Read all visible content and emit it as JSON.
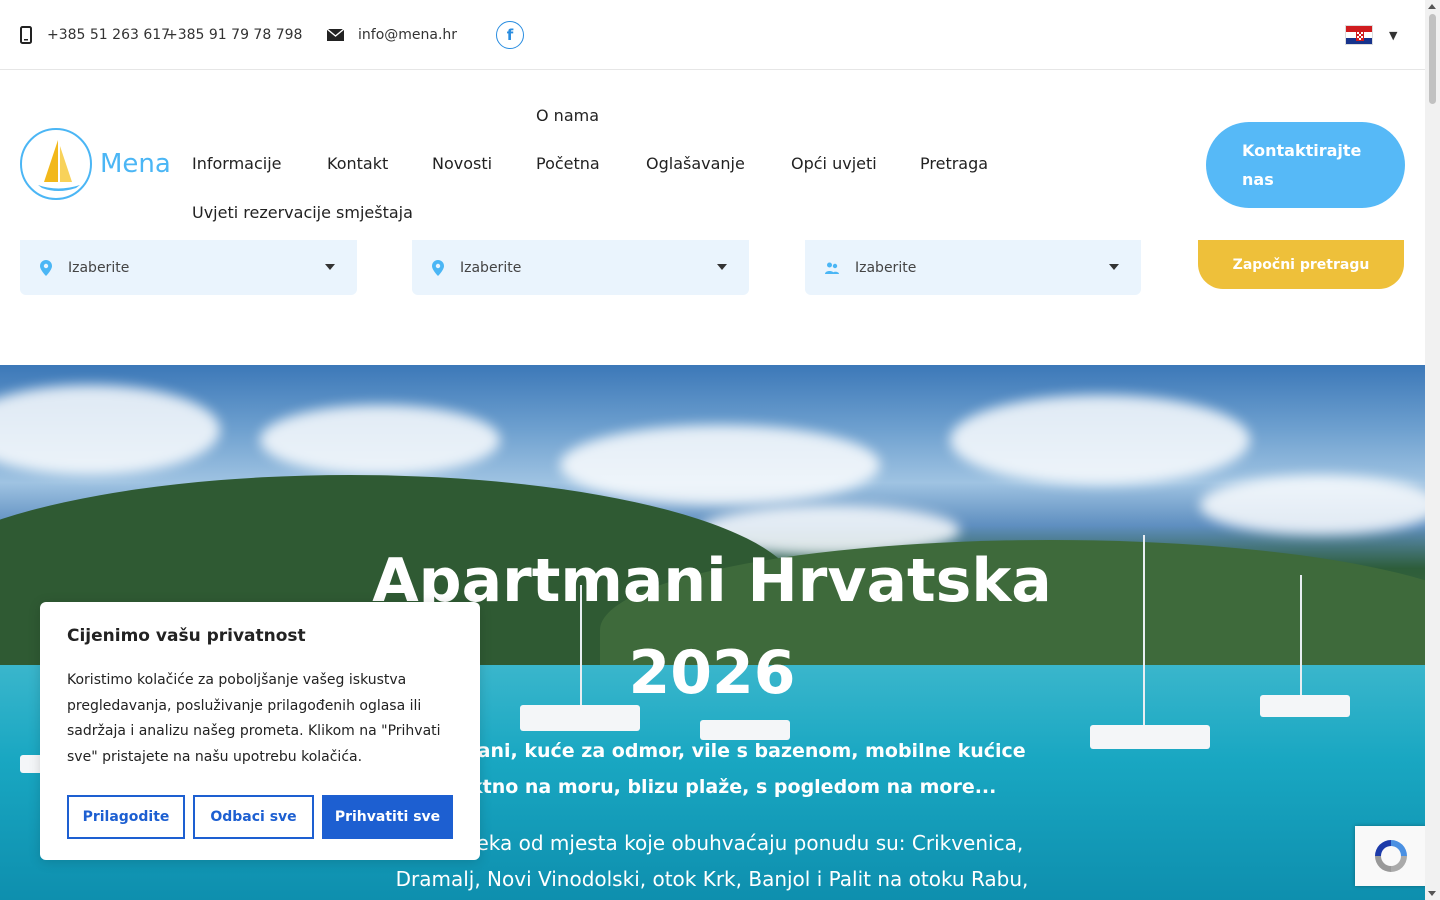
{
  "topbar": {
    "phone_icon": "mobile-phone-icon",
    "phone1": "+385 51 263 617",
    "phone2": "+385 91 79 78 798",
    "mail_icon": "envelope-icon",
    "email": "info@mena.hr",
    "facebook_icon": "facebook-icon",
    "facebook_glyph": "f",
    "language_flag": "croatia-flag-icon",
    "language_caret": "▼"
  },
  "header": {
    "logo_text": "Mena",
    "nav": {
      "o_nama": "O nama",
      "informacije": "Informacije",
      "kontakt": "Kontakt",
      "novosti": "Novosti",
      "pocetna": "Početna",
      "oglasavanje": "Oglašavanje",
      "opci_uvjeti": "Opći uvjeti",
      "pretraga": "Pretraga",
      "uvjeti_rezervacije": "Uvjeti rezervacije smještaja"
    },
    "cta_label": "Kontaktirajte nas"
  },
  "search": {
    "field1": "Izaberite",
    "field2": "Izaberite",
    "field3": "Izaberite",
    "button_label": "Započni pretragu"
  },
  "hero": {
    "title": "Apartmani Hrvatska 2026",
    "subtitle": "Apartmani, kuće za odmor, vile s bazenom, mobilne kućice direktno na moru, blizu plaže, s pogledom na more...",
    "text": "Samo neka od mjesta koje obuhvaćaju ponudu su: Crikvenica, Dramalj, Novi Vinodolski, otok Krk, Banjol i Palit na otoku Rabu,"
  },
  "cookie": {
    "title": "Cijenimo vašu privatnost",
    "text": "Koristimo kolačiće za poboljšanje vašeg iskustva pregledavanja, posluživanje prilagođenih oglasa ili sadržaja i analizu našeg prometa. Klikom na \"Prihvati sve\" pristajete na našu upotrebu kolačića.",
    "customize": "Prilagodite",
    "reject": "Odbaci sve",
    "accept": "Prihvatiti sve"
  },
  "colors": {
    "accent_blue": "#56b9f7",
    "search_yellow": "#eec03a",
    "cookie_blue": "#1d5fd1"
  }
}
